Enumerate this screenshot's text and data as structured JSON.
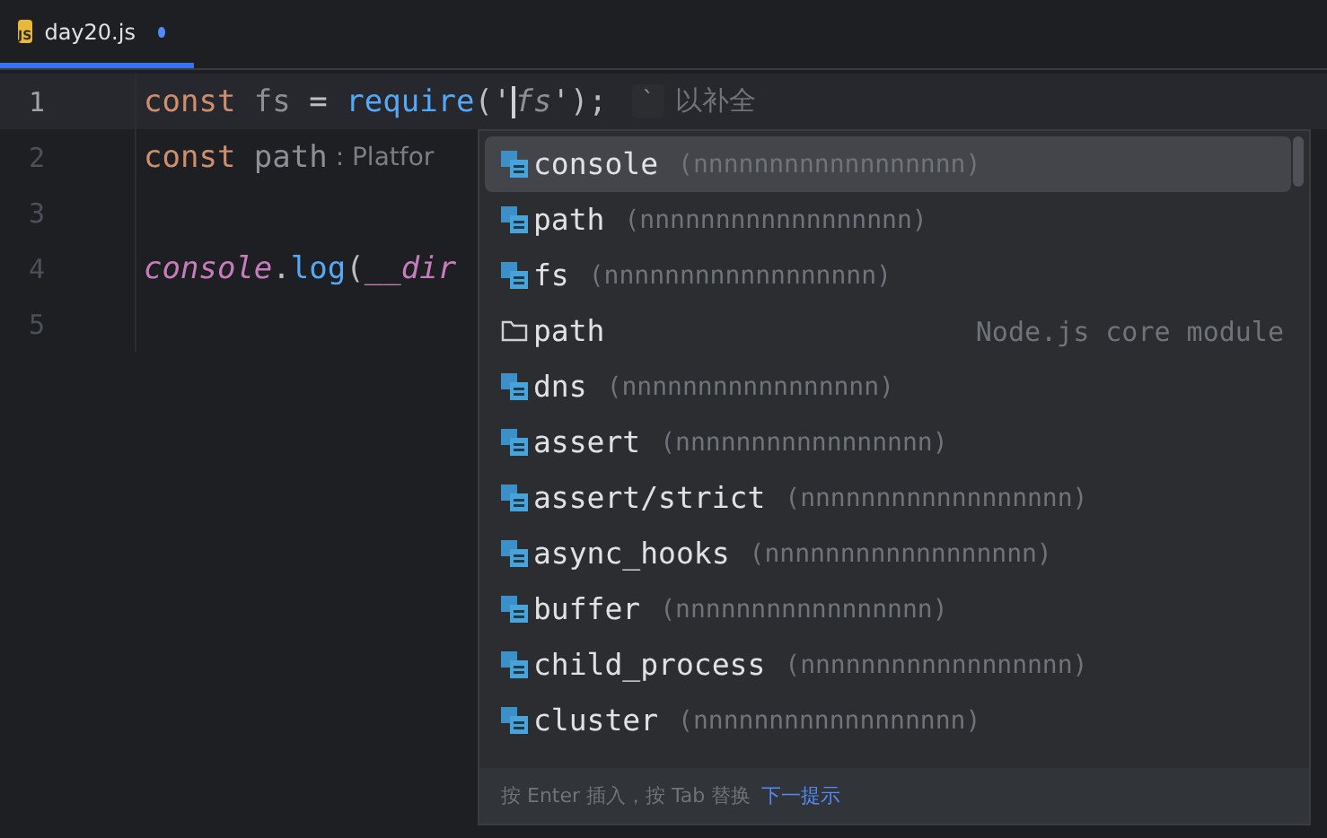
{
  "tab": {
    "icon_label": "JS",
    "title": "day20.js",
    "modified": true,
    "selected": true
  },
  "editor": {
    "lines": [
      {
        "number": "1",
        "current": true,
        "tokens": [
          {
            "kind": "keyword",
            "text": "const "
          },
          {
            "kind": "variable",
            "text": "fs"
          },
          {
            "kind": "plain",
            "text": " = "
          },
          {
            "kind": "function",
            "text": "require"
          },
          {
            "kind": "plain",
            "text": "('"
          },
          {
            "kind": "caret"
          },
          {
            "kind": "ghost",
            "text": "fs"
          },
          {
            "kind": "plain",
            "text": "');"
          }
        ],
        "hint": {
          "key": "`",
          "text": "以补全"
        }
      },
      {
        "number": "2",
        "current": false,
        "tokens": [
          {
            "kind": "keyword",
            "text": "const "
          },
          {
            "kind": "variable",
            "text": "path"
          },
          {
            "kind": "inlay",
            "text": " : Platfor"
          }
        ]
      },
      {
        "number": "3",
        "current": false
      },
      {
        "number": "4",
        "current": false,
        "tokens": [
          {
            "kind": "global",
            "text": "console"
          },
          {
            "kind": "plain",
            "text": "."
          },
          {
            "kind": "function",
            "text": "log"
          },
          {
            "kind": "plain",
            "text": "("
          },
          {
            "kind": "global",
            "text": "__dir"
          }
        ]
      },
      {
        "number": "5",
        "current": false
      }
    ]
  },
  "completion": {
    "items": [
      {
        "kind": "module",
        "name": "console",
        "detail": "(nnnnnnnnnnnnnnnnnn)",
        "selected": true
      },
      {
        "kind": "module",
        "name": "path",
        "detail": "(nnnnnnnnnnnnnnnnnn)",
        "selected": false
      },
      {
        "kind": "module",
        "name": "fs",
        "detail": "(nnnnnnnnnnnnnnnnnn)",
        "selected": false
      },
      {
        "kind": "folder",
        "name": "path",
        "detail": "Node.js core module",
        "selected": false
      },
      {
        "kind": "module",
        "name": "dns",
        "detail": "(nnnnnnnnnnnnnnnnn)",
        "selected": false
      },
      {
        "kind": "module",
        "name": "assert",
        "detail": "(nnnnnnnnnnnnnnnnn)",
        "selected": false
      },
      {
        "kind": "module",
        "name": "assert/strict",
        "detail": "(nnnnnnnnnnnnnnnnnn)",
        "selected": false
      },
      {
        "kind": "module",
        "name": "async_hooks",
        "detail": "(nnnnnnnnnnnnnnnnnn)",
        "selected": false
      },
      {
        "kind": "module",
        "name": "buffer",
        "detail": "(nnnnnnnnnnnnnnnnn)",
        "selected": false
      },
      {
        "kind": "module",
        "name": "child_process",
        "detail": "(nnnnnnnnnnnnnnnnnn)",
        "selected": false
      },
      {
        "kind": "module",
        "name": "cluster",
        "detail": "(nnnnnnnnnnnnnnnnnn)",
        "selected": false
      }
    ],
    "footer": {
      "text": "按 Enter 插入，按 Tab 替换",
      "link": "下一提示"
    }
  }
}
